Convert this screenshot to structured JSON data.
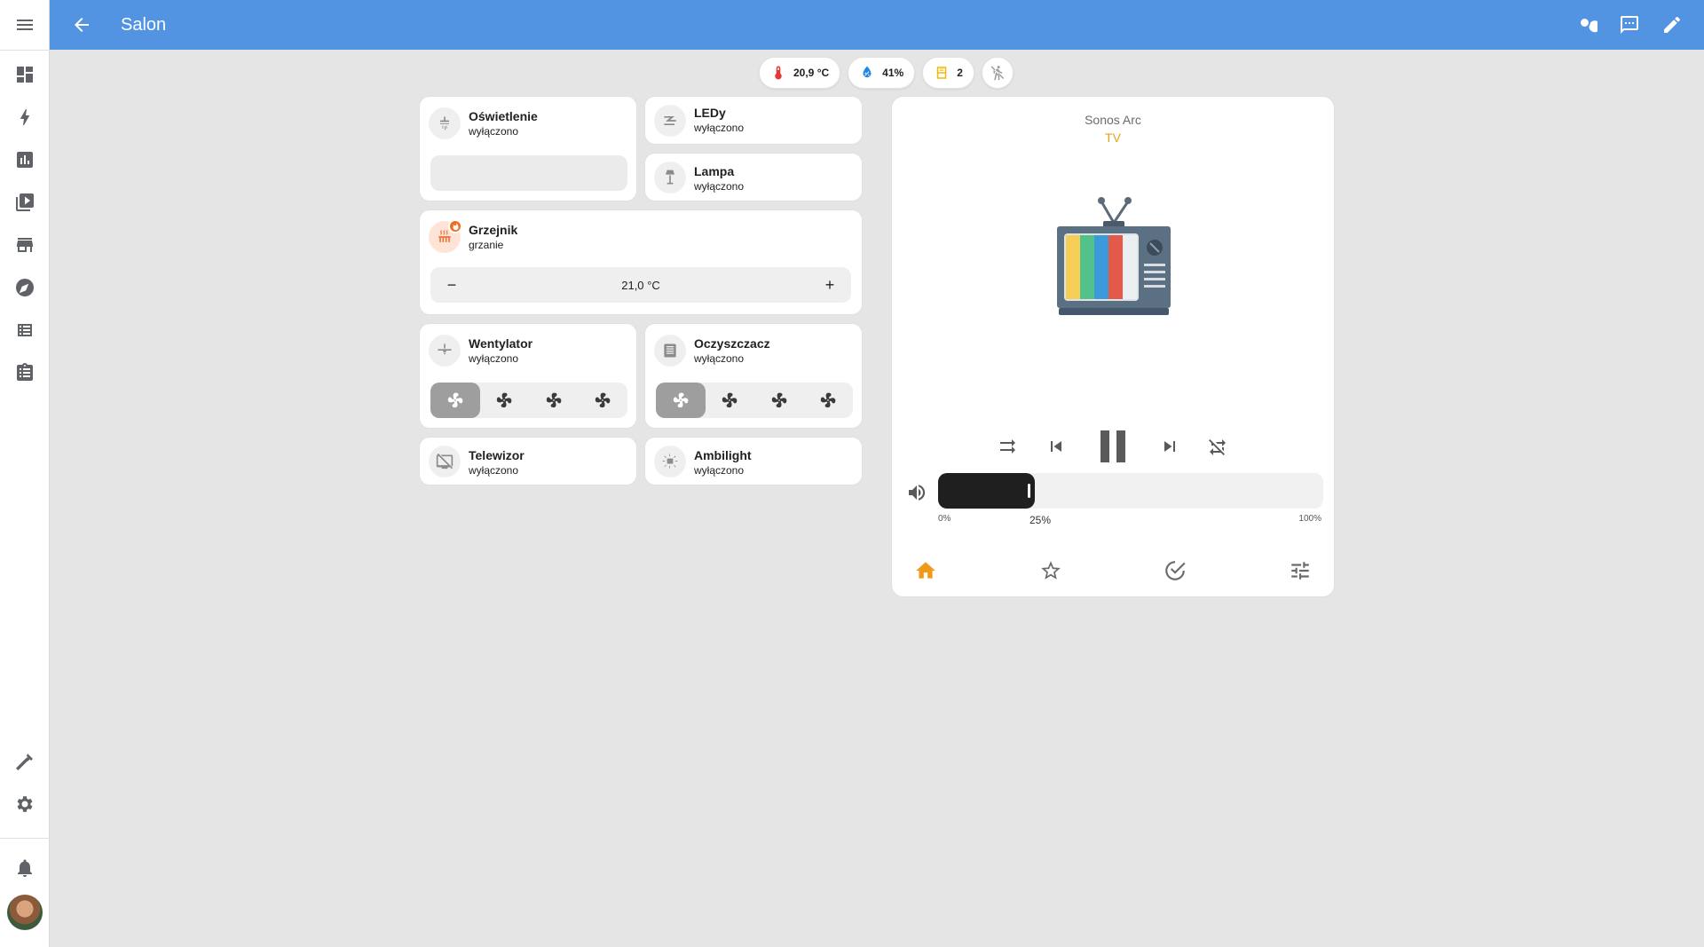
{
  "header": {
    "title": "Salon"
  },
  "sidebar": {
    "items": [
      "dashboard-icon",
      "energy-icon",
      "history-icon",
      "media-icon",
      "store-icon",
      "logbook-icon",
      "developer-icon",
      "todo-icon"
    ],
    "bottom": [
      "hammer-icon",
      "gear-icon",
      "notifications-icon",
      "avatar"
    ]
  },
  "badges": [
    {
      "icon": "thermometer-icon",
      "value": "20,9 °C",
      "color": "#e53935"
    },
    {
      "icon": "humidity-icon",
      "value": "41%",
      "color": "#1e88e5"
    },
    {
      "icon": "window-icon",
      "value": "2",
      "color": "#f2b705"
    },
    {
      "icon": "motion-off-icon",
      "value": ""
    }
  ],
  "tiles": {
    "oswietlenie": {
      "name": "Oświetlenie",
      "state": "wyłączono"
    },
    "ledy": {
      "name": "LEDy",
      "state": "wyłączono"
    },
    "lampa": {
      "name": "Lampa",
      "state": "wyłączono"
    },
    "grzejnik": {
      "name": "Grzejnik",
      "state": "grzanie",
      "target": "21,0 °C",
      "minus": "−",
      "plus": "+"
    },
    "wentylator": {
      "name": "Wentylator",
      "state": "wyłączono"
    },
    "oczyszczacz": {
      "name": "Oczyszczacz",
      "state": "wyłączono"
    },
    "telewizor": {
      "name": "Telewizor",
      "state": "wyłączono"
    },
    "ambilight": {
      "name": "Ambilight",
      "state": "wyłączono"
    }
  },
  "media": {
    "device": "Sonos Arc",
    "source": "TV",
    "volume": {
      "value": 25,
      "min_label": "0%",
      "current_label": "25%",
      "max_label": "100%"
    },
    "accent": "#f19a1a"
  }
}
